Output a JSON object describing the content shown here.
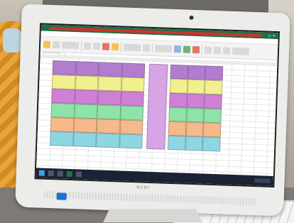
{
  "window": {
    "title": ""
  },
  "ribbon_tabs": [],
  "monitor": {
    "brand": "acer"
  },
  "colors": {
    "purple": "#b27ccf",
    "violet": "#c58fe0",
    "yellow": "#f2ef8f",
    "magenta": "#cf7fd6",
    "green": "#8ee3a8",
    "orange": "#f6b98a",
    "cyan": "#8fd6e3",
    "sheet_center": "#d7a4e6",
    "excel_green": "#1e7145",
    "accent_red": "#d3302f"
  }
}
